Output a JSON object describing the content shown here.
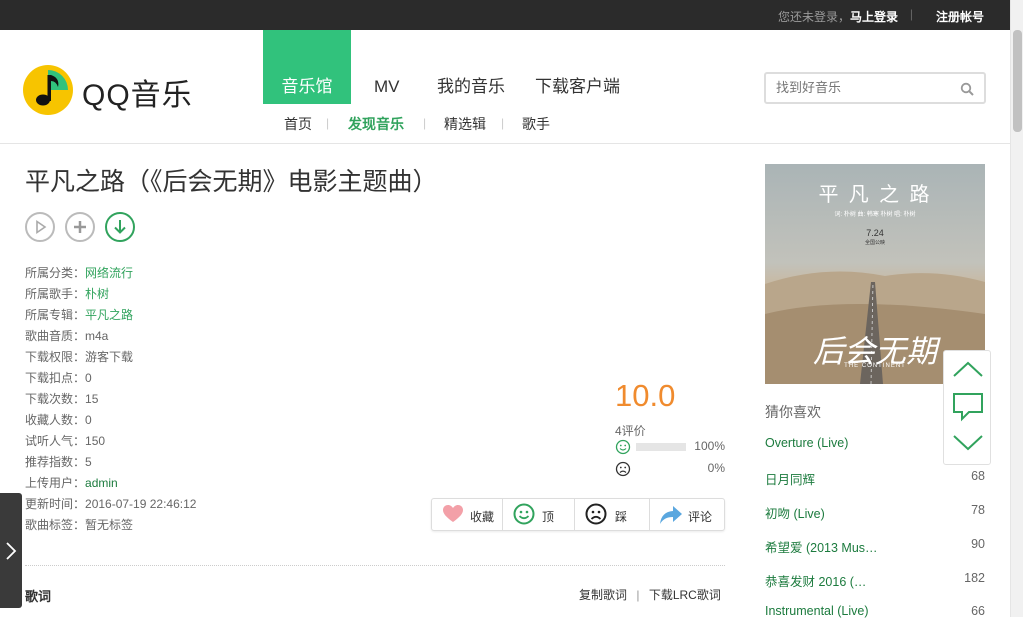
{
  "topbar": {
    "login_prefix": "您还未登录，",
    "login_link": "马上登录",
    "separator": "|",
    "register": "注册帐号"
  },
  "logo": {
    "text": "QQ音乐"
  },
  "nav": {
    "main": [
      {
        "label": "音乐馆",
        "active": true
      },
      {
        "label": "MV",
        "active": false
      },
      {
        "label": "我的音乐",
        "active": false
      },
      {
        "label": "下载客户端",
        "active": false
      }
    ],
    "sub": [
      {
        "label": "首页",
        "active": false
      },
      {
        "label": "发现音乐",
        "active": true
      },
      {
        "label": "精选辑",
        "active": false
      },
      {
        "label": "歌手",
        "active": false
      }
    ],
    "sub_divider": "|"
  },
  "search": {
    "placeholder": "找到好音乐",
    "icon": "search-icon"
  },
  "song": {
    "title": "平凡之路（《后会无期》电影主题曲）",
    "info": [
      {
        "label": "所属分类：",
        "value": "网络流行",
        "style": "link"
      },
      {
        "label": "所属歌手：",
        "value": "朴树",
        "style": "link"
      },
      {
        "label": "所属专辑：",
        "value": "平凡之路",
        "style": "link"
      },
      {
        "label": "歌曲音质：",
        "value": "m4a",
        "style": "plain"
      },
      {
        "label": "下载权限：",
        "value": "游客下载",
        "style": "plain"
      },
      {
        "label": "下载扣点：",
        "value": "0",
        "style": "plain"
      },
      {
        "label": "下载次数：",
        "value": "15",
        "style": "plain"
      },
      {
        "label": "收藏人数：",
        "value": "0",
        "style": "plain"
      },
      {
        "label": "试听人气：",
        "value": "150",
        "style": "plain"
      },
      {
        "label": "推荐指数：",
        "value": "5",
        "style": "plain"
      },
      {
        "label": "上传用户：",
        "value": "admin",
        "style": "green"
      },
      {
        "label": "更新时间：",
        "value": "2016-07-19 22:46:12",
        "style": "plain"
      },
      {
        "label": "歌曲标签：",
        "value": "暂无标签",
        "style": "plain"
      }
    ]
  },
  "rating": {
    "score": "10.0",
    "review_count": "4评价",
    "positive_pct": "100%",
    "positive_fraction": 1.0,
    "negative_pct": "0%",
    "negative_fraction": 0.0
  },
  "actions": [
    {
      "label": "收藏",
      "icon": "heart-icon"
    },
    {
      "label": "顶",
      "icon": "smile-icon"
    },
    {
      "label": "踩",
      "icon": "frown-icon"
    },
    {
      "label": "评论",
      "icon": "share-arrow-icon"
    }
  ],
  "lyrics": {
    "heading": "歌词",
    "copy_label": "复制歌词",
    "separator": "|",
    "download_label": "下载LRC歌词"
  },
  "cover": {
    "title": "平 凡 之 路",
    "credits": "词: 朴树   曲: 韩寒 朴树   唱: 朴树",
    "date": "7.24",
    "date_sub": "全国公映",
    "film_title": "后会无期",
    "film_sub": "THE CONTINENT"
  },
  "recommend": {
    "title": "猜你喜欢",
    "items": [
      {
        "name": "Overture (Live)",
        "count": ""
      },
      {
        "name": "日月同辉",
        "count": "68"
      },
      {
        "name": "初吻 (Live)",
        "count": "78"
      },
      {
        "name": "希望爱 (2013 Mus…",
        "count": "90"
      },
      {
        "name": "恭喜发财 2016 (…",
        "count": "182"
      },
      {
        "name": "Instrumental (Live)",
        "count": "66"
      }
    ]
  },
  "colors": {
    "brand_green": "#31c27c",
    "link_green": "#1c7b3e",
    "score_orange": "#f08b2e",
    "topbar": "#2b2b2b"
  }
}
